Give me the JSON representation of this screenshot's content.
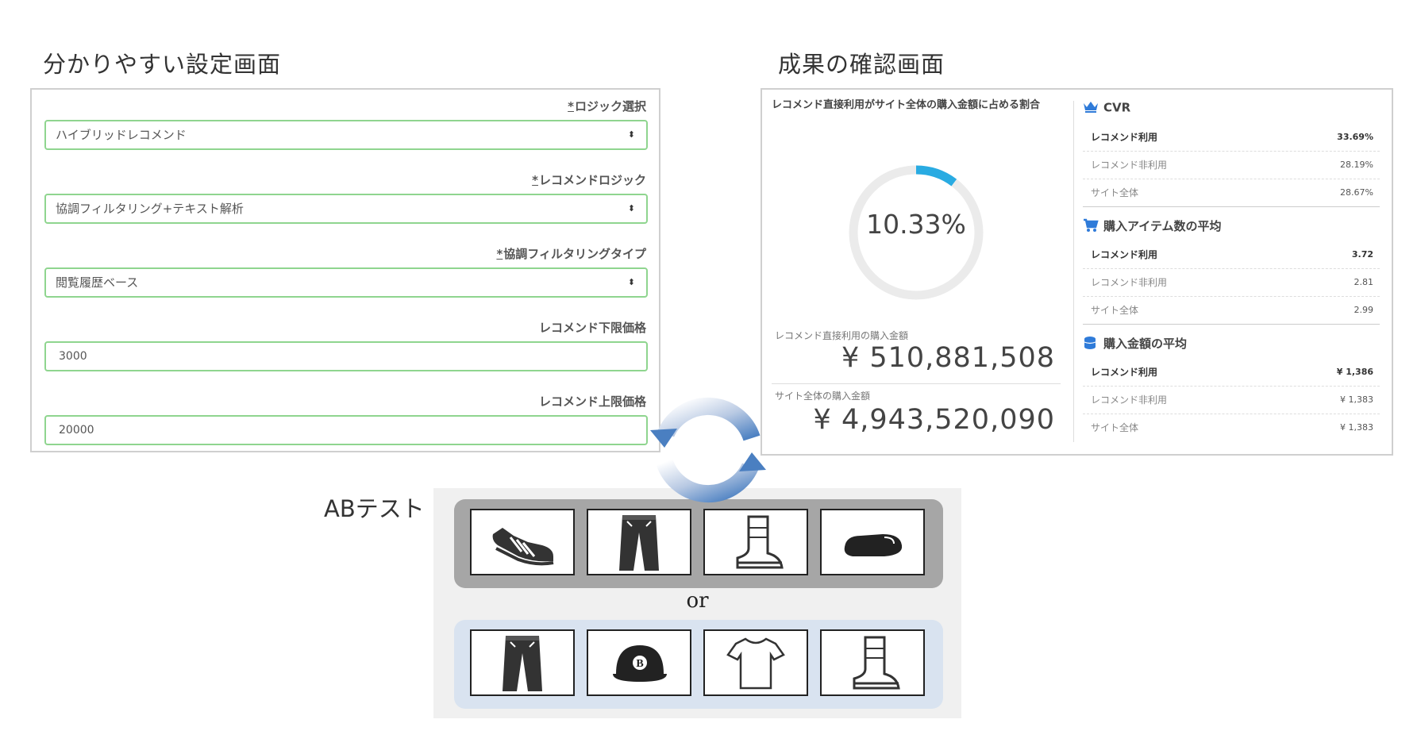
{
  "settings_title": "分かりやすい設定画面",
  "results_title": "成果の確認画面",
  "settings": {
    "fields": [
      {
        "label": "ロジック選択",
        "required_mark": "*",
        "value": "ハイブリッドレコメンド",
        "type": "select"
      },
      {
        "label": "レコメンドロジック",
        "required_mark": "*",
        "value": "協調フィルタリング+テキスト解析",
        "type": "select"
      },
      {
        "label": "協調フィルタリングタイプ",
        "required_mark": "*",
        "value": "閲覧履歴ベース",
        "type": "select"
      },
      {
        "label": "レコメンド下限価格",
        "required_mark": "",
        "value": "3000",
        "type": "input"
      },
      {
        "label": "レコメンド上限価格",
        "required_mark": "",
        "value": "20000",
        "type": "input"
      }
    ]
  },
  "results": {
    "ratio_title": "レコメンド直接利用がサイト全体の購入金額に占める割合",
    "ratio_value": "10.33%",
    "ratio_fraction": 0.1033,
    "recommend_amount_label": "レコメンド直接利用の購入金額",
    "recommend_amount": "¥ 510,881,508",
    "site_amount_label": "サイト全体の購入金額",
    "site_amount": "¥ 4,943,520,090",
    "stats": [
      {
        "icon": "crown-icon",
        "title": "CVR",
        "rows": [
          {
            "label": "レコメンド利用",
            "value": "33.69%"
          },
          {
            "label": "レコメンド非利用",
            "value": "28.19%"
          },
          {
            "label": "サイト全体",
            "value": "28.67%"
          }
        ]
      },
      {
        "icon": "cart-icon",
        "title": "購入アイテム数の平均",
        "rows": [
          {
            "label": "レコメンド利用",
            "value": "3.72"
          },
          {
            "label": "レコメンド非利用",
            "value": "2.81"
          },
          {
            "label": "サイト全体",
            "value": "2.99"
          }
        ]
      },
      {
        "icon": "coins-icon",
        "title": "購入金額の平均",
        "rows": [
          {
            "label": "レコメンド利用",
            "value": "¥ 1,386"
          },
          {
            "label": "レコメンド非利用",
            "value": "¥ 1,383"
          },
          {
            "label": "サイト全体",
            "value": "¥ 1,383"
          }
        ]
      }
    ]
  },
  "ab_test": {
    "label": "ABテスト",
    "or_label": "or",
    "variant_a_icons": [
      "sneaker-icon",
      "jeans-icon",
      "boot-icon",
      "loafer-icon"
    ],
    "variant_b_icons": [
      "jeans-icon",
      "cap-icon",
      "tshirt-icon",
      "boot-icon"
    ]
  },
  "colors": {
    "field_border": "#8fd58f",
    "donut_accent": "#29abe2",
    "donut_track": "#ebebeb",
    "variant_a_bg": "#a6a6a6",
    "variant_b_bg": "#d9e3f0",
    "icon_blue": "#2f7bd9"
  }
}
